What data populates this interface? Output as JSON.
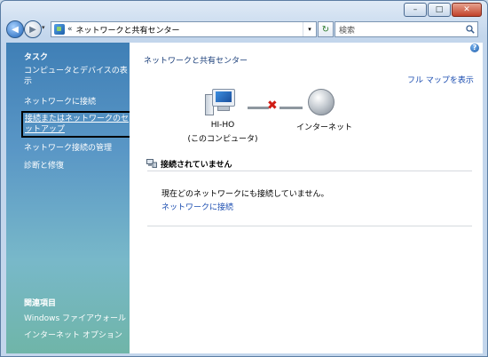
{
  "window": {
    "caption": {
      "minimize": "–",
      "maximize": "□",
      "close": "✕"
    }
  },
  "toolbar": {
    "back_glyph": "◀",
    "forward_glyph": "▶",
    "address_separator": "«",
    "address_text": "ネットワークと共有センター",
    "dropdown_glyph": "▾",
    "refresh_glyph": "↻",
    "search_placeholder": "検索"
  },
  "sidebar": {
    "tasks_title": "タスク",
    "tasks": [
      "コンピュータとデバイスの表示",
      "ネットワークに接続",
      "接続またはネットワークのセットアップ",
      "ネットワーク接続の管理",
      "診断と修復"
    ],
    "related_title": "関連項目",
    "related": [
      "Windows ファイアウォール",
      "インターネット オプション"
    ]
  },
  "main": {
    "help_glyph": "?",
    "title": "ネットワークと共有センター",
    "full_map_link": "フル マップを表示",
    "computer_name": "HI-HO",
    "computer_sub": "(このコンピュータ)",
    "disconnect_mark": "✖",
    "internet_label": "インターネット",
    "status_title": "接続されていません",
    "status_message": "現在どのネットワークにも接続していません。",
    "connect_link": "ネットワークに接続"
  }
}
